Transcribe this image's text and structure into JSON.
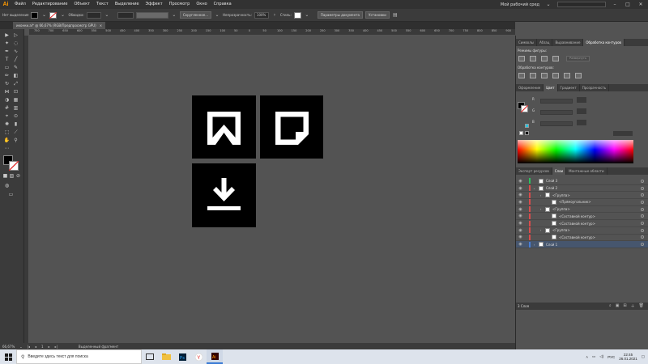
{
  "app": {
    "logo": "Ai"
  },
  "menu": [
    "Файл",
    "Редактирование",
    "Объект",
    "Текст",
    "Выделение",
    "Эффект",
    "Просмотр",
    "Окно",
    "Справка"
  ],
  "menu_right": {
    "workspace": "Мой рабочий сред",
    "search_placeholder": "Поиск в справке Adobe Stock"
  },
  "control": {
    "selection_label": "Нет выделения",
    "stroke_label": "Обводка:",
    "stroke_value": "",
    "brush_label": "Скругленное...",
    "opacity_label": "Непрозрачность:",
    "opacity_value": "100%",
    "style_label": "Стиль:",
    "doc_setup": "Параметры документа",
    "prefs": "Установки"
  },
  "document_tab": {
    "title": "иконки.ai* @ 66,67% (RGB/Предпросмотр GPU)",
    "close": "×"
  },
  "ruler_ticks": [
    "750",
    "700",
    "650",
    "600",
    "550",
    "500",
    "450",
    "400",
    "350",
    "300",
    "250",
    "200",
    "150",
    "100",
    "50",
    "0",
    "50",
    "100",
    "150",
    "200",
    "250",
    "300",
    "350",
    "400",
    "450",
    "500",
    "550",
    "600",
    "650",
    "700",
    "750",
    "800",
    "850",
    "900"
  ],
  "status": {
    "zoom": "66,67%",
    "artboard": "1",
    "selection_info": "Выделенный фрагмент"
  },
  "panels": {
    "top_tabs": [
      "Символы",
      "Абзац",
      "Выравнивание",
      "Обработка контуров"
    ],
    "shape_modes_label": "Режимы фигуры:",
    "expand_btn": "Развернуть",
    "pathfinders_label": "Обработка контуров:",
    "color_tabs": [
      "Оформление",
      "Цвет",
      "Градиент",
      "Прозрачность"
    ],
    "rgb_labels": [
      "R",
      "G",
      "B"
    ],
    "hex_value": "",
    "layer_tabs": [
      "Экспорт ресурсов",
      "Слои",
      "Монтажные области"
    ],
    "layers": [
      {
        "name": "Слой 3",
        "indent": 0,
        "expander": "",
        "color": "#2fbf5f"
      },
      {
        "name": "Слой 2",
        "indent": 0,
        "expander": "⌄",
        "color": "#d94c4c"
      },
      {
        "name": "<Группа>",
        "indent": 1,
        "expander": "›",
        "color": "#d94c4c"
      },
      {
        "name": "<Прямоугольник>",
        "indent": 2,
        "expander": "",
        "color": "#d94c4c"
      },
      {
        "name": "<Группа>",
        "indent": 1,
        "expander": "›",
        "color": "#d94c4c"
      },
      {
        "name": "<Составной контур>",
        "indent": 2,
        "expander": "",
        "color": "#d94c4c"
      },
      {
        "name": "<Составной контур>",
        "indent": 2,
        "expander": "",
        "color": "#d94c4c"
      },
      {
        "name": "<Группа>",
        "indent": 1,
        "expander": "›",
        "color": "#d94c4c"
      },
      {
        "name": "<Составной контур>",
        "indent": 2,
        "expander": "",
        "color": "#d94c4c"
      },
      {
        "name": "Слой 1",
        "indent": 0,
        "expander": "›",
        "color": "#4a7fd4",
        "selected": true
      }
    ],
    "layers_count": "3 Слоя"
  },
  "taskbar": {
    "search_text": "Введите здесь текст для поиска",
    "lang": "РУС",
    "time": "22:45",
    "date": "26.01.2021"
  },
  "colors": {
    "accent": "#ff9a00",
    "selection": "#46566e"
  }
}
